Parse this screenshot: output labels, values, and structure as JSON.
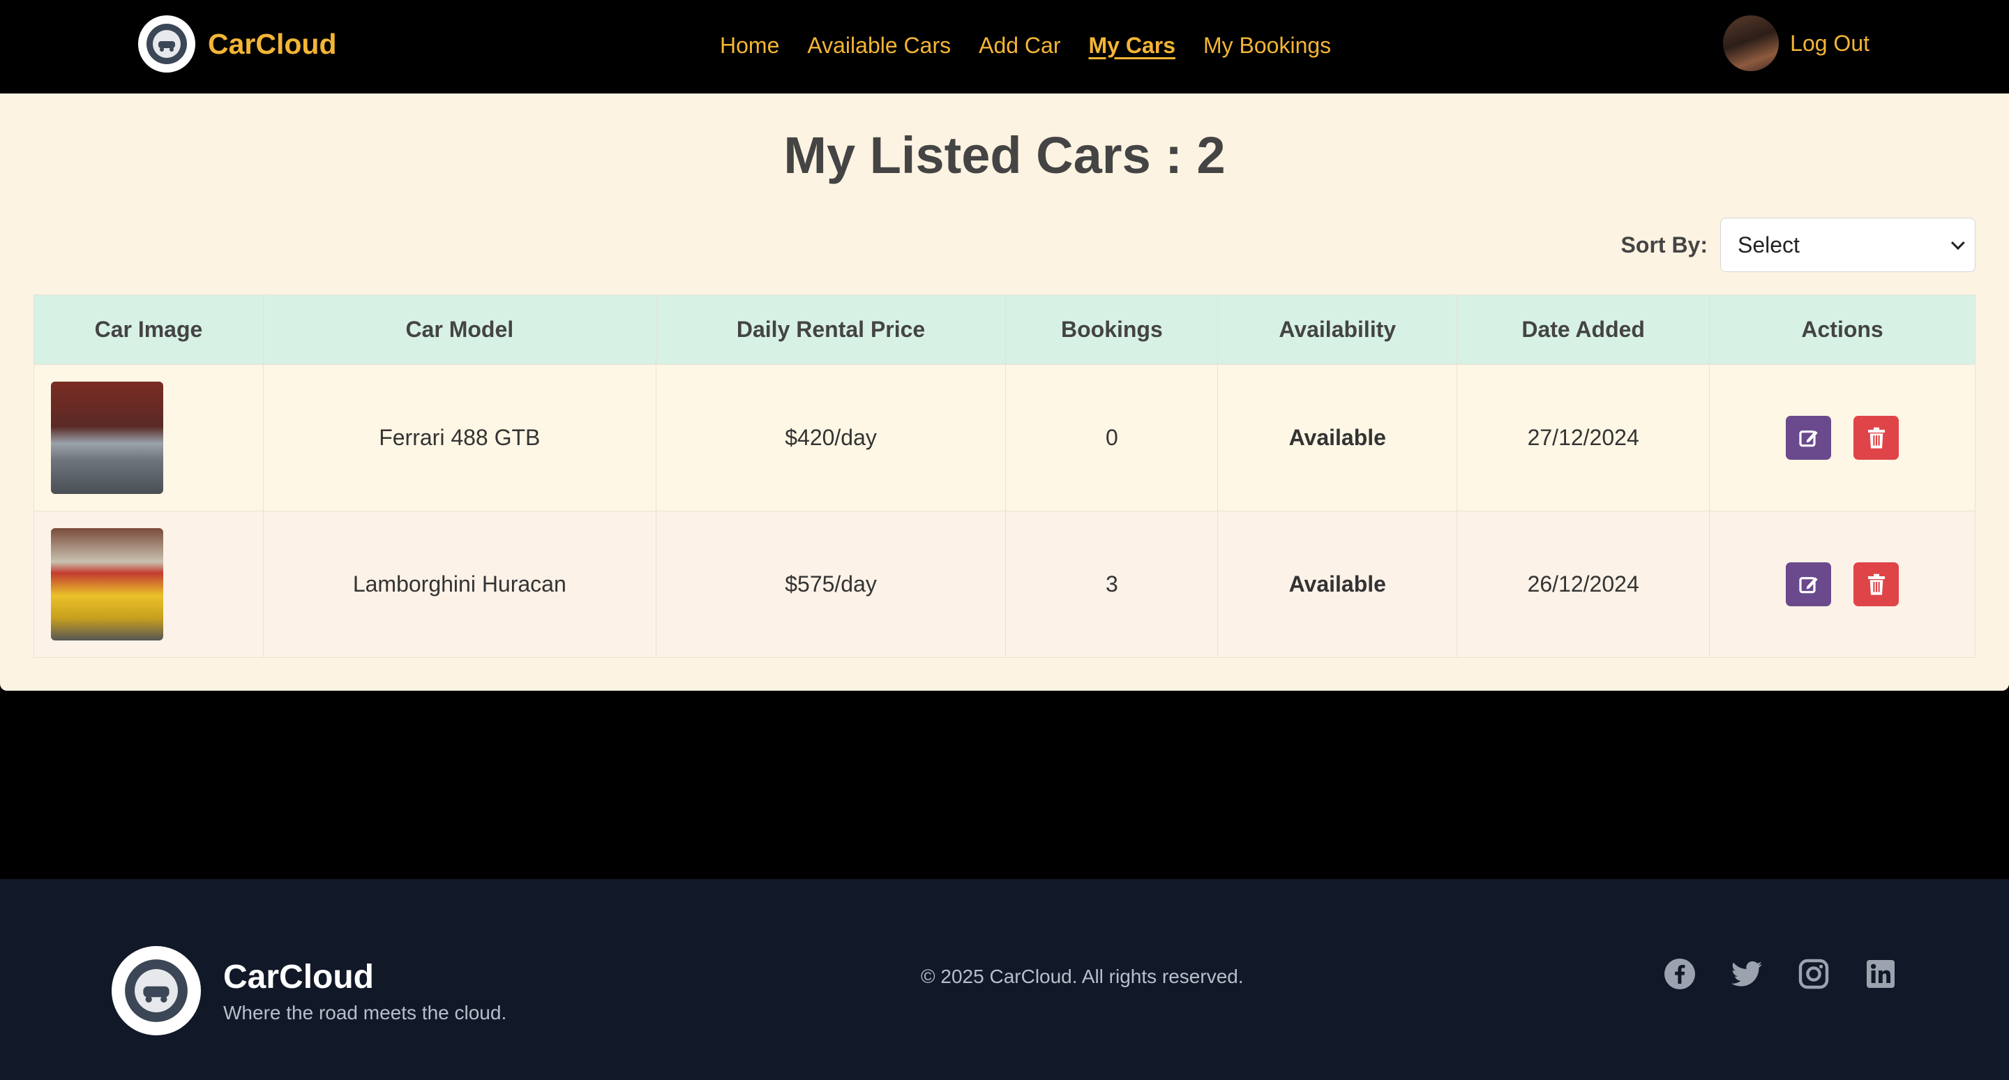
{
  "nav": {
    "brand": "CarCloud",
    "links": [
      "Home",
      "Available Cars",
      "Add Car",
      "My Cars",
      "My Bookings"
    ],
    "active": "My Cars",
    "logout": "Log Out"
  },
  "page": {
    "title": "My Listed Cars : 2",
    "sort_label": "Sort By:",
    "sort_value": "Select"
  },
  "table": {
    "headers": [
      "Car Image",
      "Car Model",
      "Daily Rental Price",
      "Bookings",
      "Availability",
      "Date Added",
      "Actions"
    ],
    "rows": [
      {
        "model": "Ferrari 488 GTB",
        "price": "$420/day",
        "bookings": "0",
        "availability": "Available",
        "date": "27/12/2024"
      },
      {
        "model": "Lamborghini Huracan",
        "price": "$575/day",
        "bookings": "3",
        "availability": "Available",
        "date": "26/12/2024"
      }
    ]
  },
  "footer": {
    "brand": "CarCloud",
    "tagline": "Where the road meets the cloud.",
    "copyright": "© 2025 CarCloud. All rights reserved.",
    "socials": [
      "facebook-icon",
      "twitter-icon",
      "instagram-icon",
      "linkedin-icon"
    ]
  },
  "colors": {
    "accent": "#f4b535",
    "header_bg": "#d8f1e5",
    "available": "#1e9a4b",
    "edit": "#6a4a8c",
    "delete": "#df4548",
    "footer_bg": "#111827"
  }
}
